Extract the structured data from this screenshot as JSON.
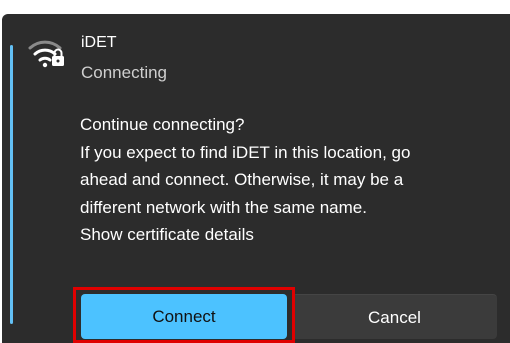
{
  "network": {
    "name": "iDET",
    "status": "Connecting",
    "icon": "wifi-secured-icon"
  },
  "message": {
    "lines": [
      "Continue connecting?",
      "If you expect to find iDET in this location, go",
      "ahead and connect. Otherwise, it may be a",
      "different network with the same name.",
      "Show certificate details"
    ]
  },
  "buttons": {
    "connect_label": "Connect",
    "cancel_label": "Cancel"
  },
  "colors": {
    "panel_bg": "#2c2c2c",
    "accent": "#4cc2ff",
    "accent_bar": "#63c0f5",
    "highlight": "#e00000"
  }
}
